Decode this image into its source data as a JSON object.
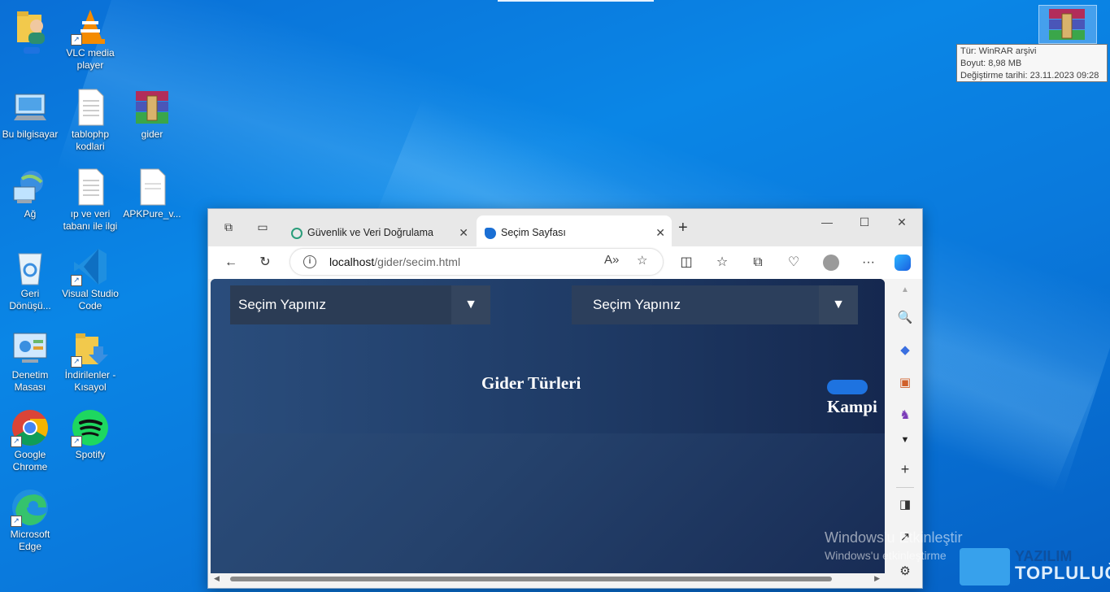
{
  "desktop": {
    "icons": [
      {
        "label": "",
        "icon": "user-folder-icon"
      },
      {
        "label": "VLC media player",
        "icon": "vlc-icon"
      },
      {
        "label": "Bu bilgisayar",
        "icon": "computer-icon"
      },
      {
        "label": "tablophp kodlari",
        "icon": "text-file-icon"
      },
      {
        "label": "gider",
        "icon": "winrar-icon"
      },
      {
        "label": "Ağ",
        "icon": "network-icon"
      },
      {
        "label": "ıp ve veri tabanı ile ilgi",
        "icon": "text-file-icon"
      },
      {
        "label": "APKPure_v...",
        "icon": "file-icon"
      },
      {
        "label": "Geri Dönüşü...",
        "icon": "recycle-bin-icon"
      },
      {
        "label": "Visual Studio Code",
        "icon": "vscode-icon"
      },
      {
        "label": "Denetim Masası",
        "icon": "control-panel-icon"
      },
      {
        "label": "İndirilenler - Kısayol",
        "icon": "downloads-folder-icon"
      },
      {
        "label": "Google Chrome",
        "icon": "chrome-icon"
      },
      {
        "label": "Spotify",
        "icon": "spotify-icon"
      },
      {
        "label": "Microsoft Edge",
        "icon": "edge-icon"
      }
    ]
  },
  "tooltip": {
    "line1": "Tür: WinRAR arşivi",
    "line2": "Boyut: 8,98 MB",
    "line3": "Değiştirme tarihi: 23.11.2023 09:28"
  },
  "browser": {
    "tabs": [
      {
        "title": "Güvenlik ve Veri Doğrulama",
        "active": false
      },
      {
        "title": "Seçim Sayfası",
        "active": true
      }
    ],
    "url_host": "localhost",
    "url_path": "/gider/secim.html",
    "page": {
      "select1": "Seçim Yapınız",
      "select2": "Seçim Yapınız",
      "heading": "Gider Türleri",
      "side_heading_line2": "Kampi"
    }
  },
  "watermark": {
    "line1": "Windows'u Etkinleştir",
    "line2": "Windows'u etkinleştirme"
  },
  "logo": {
    "line1": "YAZILIM",
    "line2": "TOPLULUĞU"
  }
}
